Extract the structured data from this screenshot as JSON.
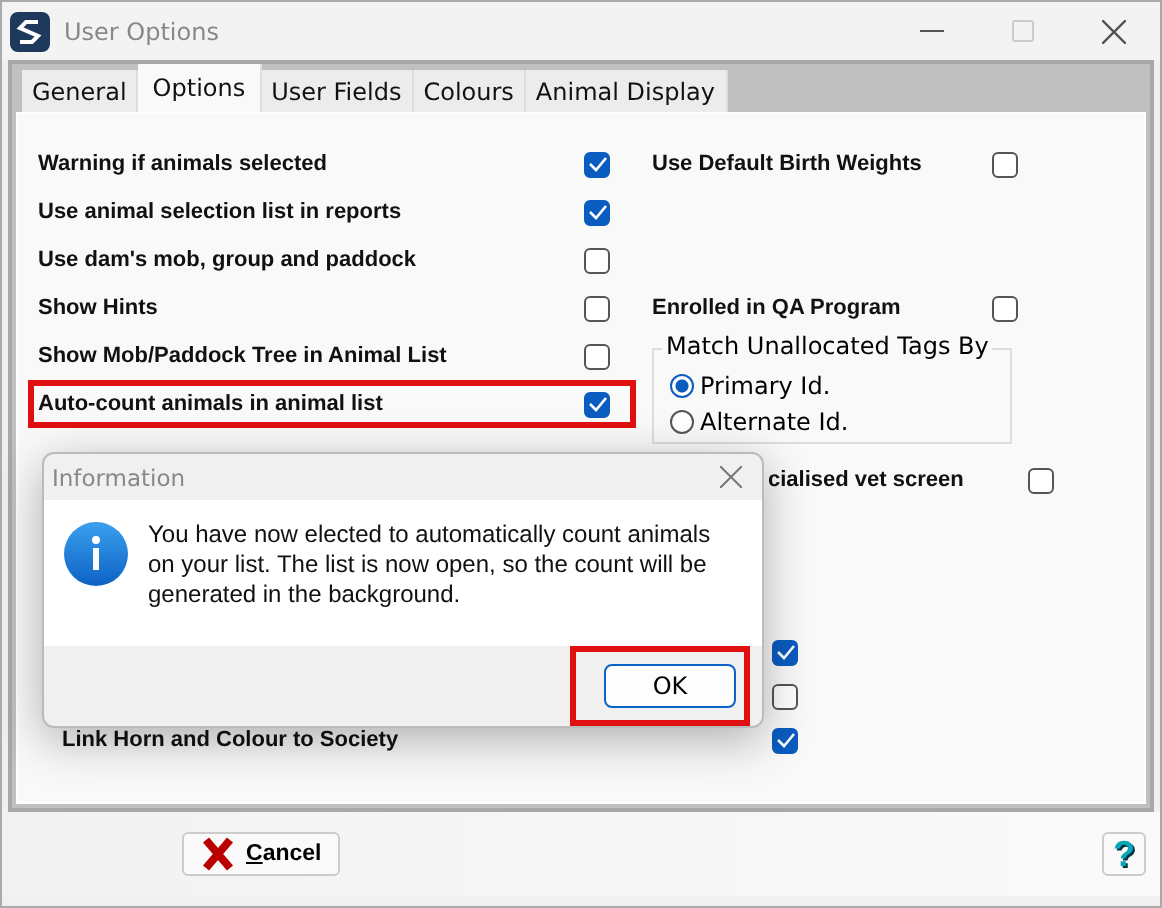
{
  "window": {
    "title": "User Options"
  },
  "tabs": [
    {
      "label": "General",
      "selected": false
    },
    {
      "label": "Options",
      "selected": true
    },
    {
      "label": "User Fields",
      "selected": false
    },
    {
      "label": "Colours",
      "selected": false
    },
    {
      "label": "Animal Display",
      "selected": false
    }
  ],
  "options_left": [
    {
      "label": "Warning if animals selected",
      "checked": true,
      "highlighted": false
    },
    {
      "label": "Use animal selection list in reports",
      "checked": true,
      "highlighted": false
    },
    {
      "label": "Use dam's mob, group and paddock",
      "checked": false,
      "highlighted": false
    },
    {
      "label": "Show Hints",
      "checked": false,
      "highlighted": false
    },
    {
      "label": "Show Mob/Paddock Tree in Animal List",
      "checked": false,
      "highlighted": false
    },
    {
      "label": "Auto-count animals in animal list",
      "checked": true,
      "highlighted": true
    }
  ],
  "options_right": [
    {
      "label": "Use Default Birth Weights",
      "checked": false
    },
    {
      "label": "Enrolled in QA Program",
      "checked": false
    }
  ],
  "match_tags": {
    "title": "Match Unallocated Tags By",
    "options": [
      {
        "label": "Primary Id.",
        "selected": true
      },
      {
        "label": "Alternate Id.",
        "selected": false
      }
    ]
  },
  "vet_option": {
    "label": "cialised vet screen",
    "checked": false
  },
  "lower_options": [
    {
      "checked": true
    },
    {
      "checked": false
    },
    {
      "label": "Link Horn and Colour to Society",
      "checked": true
    }
  ],
  "dialog": {
    "title": "Information",
    "message": "You have now elected to automatically count animals on your list. The list is now open, so the count will be generated in the background.",
    "button": {
      "label": "OK",
      "highlighted": true
    }
  },
  "footer": {
    "cancel": "Cancel",
    "help": "?"
  }
}
